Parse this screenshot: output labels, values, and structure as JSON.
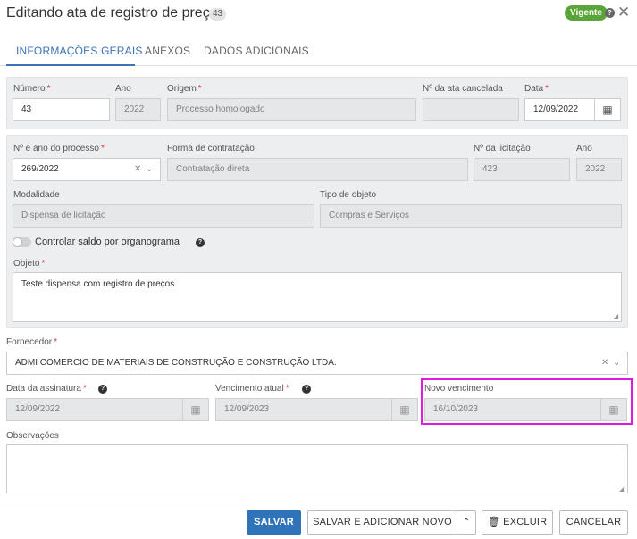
{
  "header": {
    "title": "Editando ata de registro de preço",
    "count": "43",
    "status": "Vigente",
    "status_color": "#5aa53a",
    "help_icon": "question-circle-icon",
    "close_icon": "close-icon"
  },
  "tabs": [
    {
      "label": "INFORMAÇÕES GERAIS",
      "active": true
    },
    {
      "label": "ANEXOS",
      "active": false
    },
    {
      "label": "DADOS ADICIONAIS",
      "active": false
    }
  ],
  "section1": {
    "numero_label": "Número",
    "numero_value": "43",
    "ano_label": "Ano",
    "ano_value": "2022",
    "origem_label": "Origem",
    "origem_value": "Processo homologado",
    "ata_cancelada_label": "Nº da ata cancelada",
    "ata_cancelada_value": "",
    "data_label": "Data",
    "data_value": "12/09/2022"
  },
  "section2": {
    "processo_label": "Nº e ano do processo",
    "processo_value": "269/2022",
    "forma_label": "Forma de contratação",
    "forma_value": "Contratação direta",
    "licitacao_label": "Nº da licitação",
    "licitacao_value": "423",
    "ano_label": "Ano",
    "ano_value": "2022",
    "modalidade_label": "Modalidade",
    "modalidade_value": "Dispensa de licitação",
    "tipo_label": "Tipo de objeto",
    "tipo_value": "Compras e Serviços",
    "toggle_label": "Controlar saldo por organograma",
    "toggle_on": false,
    "objeto_label": "Objeto",
    "objeto_value": "Teste dispensa com registro de preços"
  },
  "fornecedor": {
    "label": "Fornecedor",
    "value": "ADMI COMERCIO DE MATERIAIS DE CONSTRUÇÃO E CONSTRUÇÃO LTDA."
  },
  "datas": {
    "assinatura_label": "Data da assinatura",
    "assinatura_value": "12/09/2022",
    "vencimento_label": "Vencimento atual",
    "vencimento_value": "12/09/2023",
    "novo_label": "Novo vencimento",
    "novo_value": "16/10/2023"
  },
  "observacoes": {
    "label": "Observações",
    "value": ""
  },
  "footer": {
    "save": "SALVAR",
    "save_add": "SALVAR E ADICIONAR NOVO",
    "delete": "EXCLUIR",
    "cancel": "CANCELAR"
  }
}
